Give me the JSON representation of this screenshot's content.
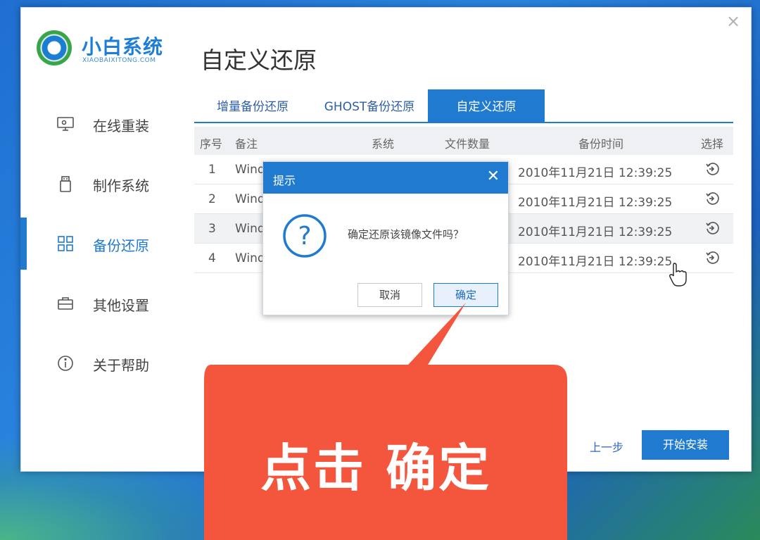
{
  "app": {
    "brand_name": "小白系统",
    "brand_sub": "XIAOBAIXITONG.COM",
    "page_title": "自定义还原"
  },
  "sidebar": {
    "items": [
      {
        "label": "在线重装",
        "icon": "monitor-icon"
      },
      {
        "label": "制作系统",
        "icon": "usb-icon"
      },
      {
        "label": "备份还原",
        "icon": "grid-icon",
        "active": true
      },
      {
        "label": "其他设置",
        "icon": "briefcase-icon"
      },
      {
        "label": "关于帮助",
        "icon": "info-icon"
      }
    ]
  },
  "tabs": [
    {
      "label": "增量备份还原"
    },
    {
      "label": "GHOST备份还原"
    },
    {
      "label": "自定义还原",
      "active": true
    }
  ],
  "table": {
    "headers": [
      "序号",
      "备注",
      "系统",
      "文件数量",
      "备份时间",
      "选择"
    ],
    "rows": [
      {
        "index": "1",
        "note": "Wind",
        "time": "2010年11月21日 12:39:25"
      },
      {
        "index": "2",
        "note": "Wind",
        "time": "2010年11月21日 12:39:25"
      },
      {
        "index": "3",
        "note": "Wind",
        "time": "2010年11月21日 12:39:25"
      },
      {
        "index": "4",
        "note": "Wind",
        "time": "2010年11月21日 12:39:25"
      }
    ]
  },
  "nav": {
    "prev_label": "上一步",
    "start_label": "开始安装"
  },
  "dialog": {
    "title": "提示",
    "message": "确定还原该镜像文件吗？",
    "cancel_label": "取消",
    "ok_label": "确定"
  },
  "annotation": {
    "text": "点击 确定"
  },
  "colors": {
    "accent": "#1f7ad0",
    "callout": "#f4553d"
  }
}
